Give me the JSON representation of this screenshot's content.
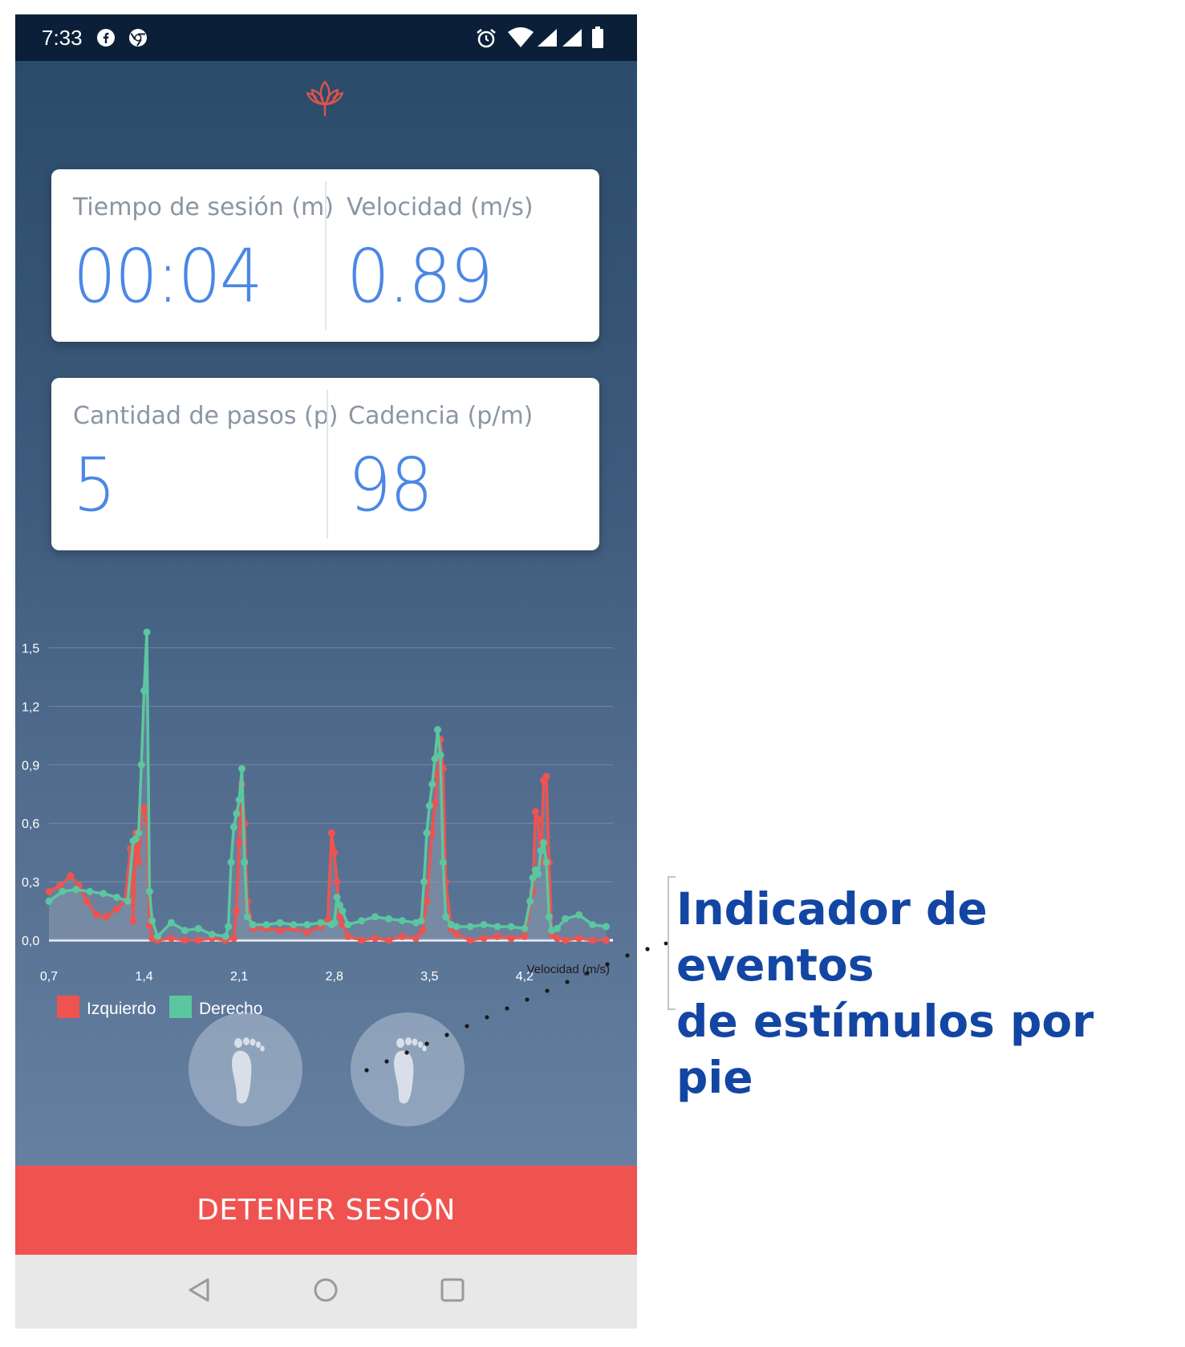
{
  "status_bar": {
    "time": "7:33",
    "left_icons": [
      "facebook-icon",
      "chrome-icon"
    ],
    "right_icons": [
      "alarm-icon",
      "wifi-icon",
      "signal-icon",
      "signal-icon",
      "battery-icon"
    ]
  },
  "app": {
    "logo": "lotus-icon",
    "colors": {
      "accent": "#ef5350",
      "value_blue": "#4b87e6",
      "left_series": "#ef5350",
      "right_series": "#5bc7a0"
    }
  },
  "metrics": {
    "session_time": {
      "label": "Tiempo de sesión (m)",
      "value": "00:04"
    },
    "speed": {
      "label": "Velocidad (m/s)",
      "value": "0.89"
    },
    "steps": {
      "label": "Cantidad de pasos (p)",
      "value": "5"
    },
    "cadence": {
      "label": "Cadencia (p/m)",
      "value": "98"
    }
  },
  "chart_data": {
    "type": "line",
    "xlabel": "Velocidad (m/s)",
    "ylabel": "",
    "xlim": [
      0.7,
      4.85
    ],
    "ylim": [
      0,
      1.65
    ],
    "x_ticks": [
      "0,7",
      "1,4",
      "2,1",
      "2,8",
      "3,5",
      "4,2"
    ],
    "y_ticks": [
      "0,0",
      "0,3",
      "0,6",
      "0,9",
      "1,2",
      "1,5"
    ],
    "grid": true,
    "legend_position": "bottom-left",
    "series": [
      {
        "name": "Izquierdo",
        "color": "#ef5350",
        "x": [
          0.7,
          0.78,
          0.86,
          0.92,
          0.98,
          1.05,
          1.12,
          1.2,
          1.26,
          1.3,
          1.32,
          1.34,
          1.36,
          1.38,
          1.4,
          1.42,
          1.44,
          1.46,
          1.5,
          1.6,
          1.7,
          1.8,
          1.9,
          2.0,
          2.06,
          2.08,
          2.1,
          2.12,
          2.14,
          2.16,
          2.2,
          2.3,
          2.4,
          2.5,
          2.6,
          2.7,
          2.75,
          2.78,
          2.8,
          2.82,
          2.84,
          2.86,
          2.9,
          3.0,
          3.1,
          3.2,
          3.3,
          3.4,
          3.45,
          3.48,
          3.52,
          3.54,
          3.56,
          3.58,
          3.6,
          3.62,
          3.66,
          3.7,
          3.8,
          3.9,
          4.0,
          4.1,
          4.2,
          4.26,
          4.28,
          4.3,
          4.32,
          4.34,
          4.36,
          4.38,
          4.4,
          4.44,
          4.5,
          4.6,
          4.7,
          4.8
        ],
        "values": [
          0.25,
          0.28,
          0.33,
          0.28,
          0.2,
          0.13,
          0.12,
          0.16,
          0.2,
          0.47,
          0.1,
          0.55,
          0.4,
          0.66,
          0.68,
          0.62,
          0.08,
          0.01,
          0.0,
          0.01,
          0.0,
          0.0,
          0.01,
          0.0,
          0.01,
          0.15,
          0.5,
          0.8,
          0.6,
          0.2,
          0.06,
          0.06,
          0.05,
          0.06,
          0.04,
          0.07,
          0.1,
          0.55,
          0.45,
          0.3,
          0.12,
          0.08,
          0.02,
          0.0,
          0.01,
          0.0,
          0.02,
          0.01,
          0.05,
          0.2,
          0.55,
          0.7,
          0.85,
          1.03,
          0.88,
          0.3,
          0.06,
          0.03,
          0.0,
          0.01,
          0.02,
          0.01,
          0.02,
          0.25,
          0.66,
          0.62,
          0.4,
          0.82,
          0.84,
          0.4,
          0.03,
          0.01,
          0.0,
          0.01,
          0.0,
          0.0
        ]
      },
      {
        "name": "Derecho",
        "color": "#5bc7a0",
        "x": [
          0.7,
          0.8,
          0.9,
          1.0,
          1.1,
          1.2,
          1.28,
          1.32,
          1.34,
          1.36,
          1.38,
          1.4,
          1.42,
          1.44,
          1.46,
          1.5,
          1.6,
          1.7,
          1.8,
          1.9,
          2.0,
          2.02,
          2.04,
          2.06,
          2.08,
          2.1,
          2.12,
          2.14,
          2.16,
          2.2,
          2.3,
          2.4,
          2.5,
          2.6,
          2.7,
          2.78,
          2.8,
          2.82,
          2.84,
          2.86,
          2.9,
          3.0,
          3.1,
          3.2,
          3.3,
          3.4,
          3.44,
          3.46,
          3.48,
          3.5,
          3.52,
          3.54,
          3.56,
          3.58,
          3.6,
          3.62,
          3.66,
          3.7,
          3.8,
          3.9,
          4.0,
          4.1,
          4.2,
          4.24,
          4.26,
          4.28,
          4.3,
          4.32,
          4.34,
          4.36,
          4.38,
          4.4,
          4.44,
          4.5,
          4.6,
          4.7,
          4.8
        ],
        "values": [
          0.2,
          0.25,
          0.26,
          0.25,
          0.24,
          0.22,
          0.2,
          0.51,
          0.52,
          0.55,
          0.9,
          1.28,
          1.58,
          0.25,
          0.1,
          0.02,
          0.09,
          0.05,
          0.06,
          0.03,
          0.02,
          0.07,
          0.4,
          0.58,
          0.65,
          0.72,
          0.88,
          0.4,
          0.12,
          0.08,
          0.08,
          0.09,
          0.08,
          0.08,
          0.09,
          0.08,
          0.09,
          0.22,
          0.18,
          0.15,
          0.08,
          0.1,
          0.12,
          0.11,
          0.1,
          0.09,
          0.1,
          0.3,
          0.55,
          0.69,
          0.8,
          0.93,
          1.08,
          0.95,
          0.4,
          0.12,
          0.08,
          0.07,
          0.07,
          0.08,
          0.07,
          0.07,
          0.06,
          0.2,
          0.32,
          0.36,
          0.34,
          0.46,
          0.5,
          0.4,
          0.12,
          0.05,
          0.06,
          0.11,
          0.13,
          0.08,
          0.07
        ]
      }
    ]
  },
  "foot_buttons": [
    {
      "id": "left",
      "icon": "footprint-icon"
    },
    {
      "id": "right",
      "icon": "footprint-icon"
    }
  ],
  "actions": {
    "stop_label": "DETENER SESIÓN"
  },
  "nav_bar": {
    "icons": [
      "back-icon",
      "home-icon",
      "recents-icon"
    ]
  },
  "annotation": {
    "text": "Indicador de eventos\nde estímulos por pie"
  }
}
